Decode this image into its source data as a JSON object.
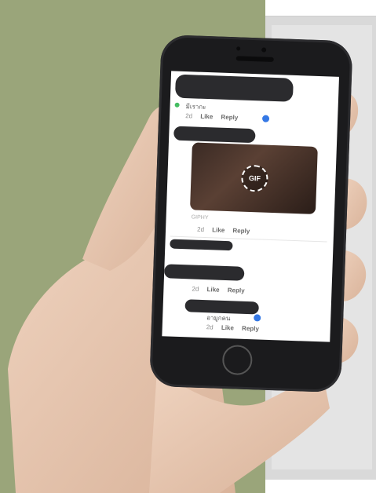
{
  "comments": [
    {
      "name": "มีเรากะ",
      "time": "2d",
      "like": "Like",
      "reply": "Reply"
    },
    {
      "gif_badge": "GIF",
      "source": "GIPHY",
      "time": "2d",
      "like": "Like",
      "reply": "Reply"
    },
    {
      "time": "2d",
      "like": "Like",
      "reply": "Reply"
    },
    {
      "name": "อามูกคน",
      "time": "2d",
      "like": "Like",
      "reply": "Reply"
    }
  ],
  "colors": {
    "background_green": "#9aa57a",
    "reaction_blue": "#3578e5",
    "online_green": "#45bd62"
  }
}
